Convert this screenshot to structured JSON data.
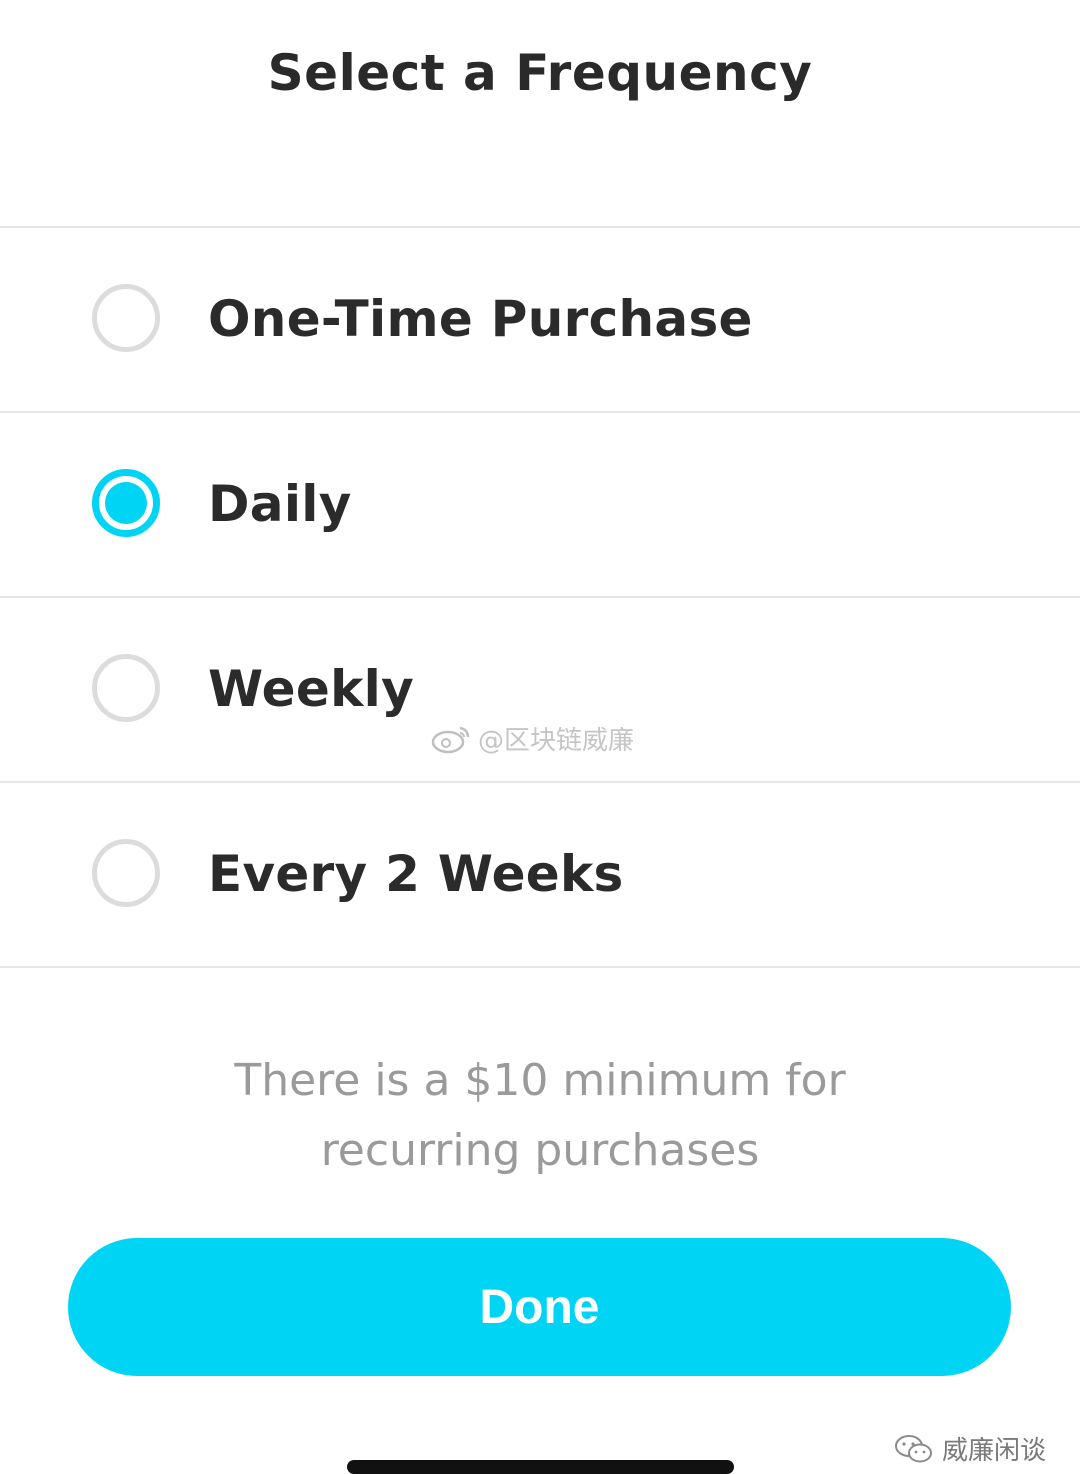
{
  "title": "Select a Frequency",
  "options": [
    {
      "label": "One-Time Purchase",
      "selected": false
    },
    {
      "label": "Daily",
      "selected": true
    },
    {
      "label": "Weekly",
      "selected": false
    },
    {
      "label": "Every 2 Weeks",
      "selected": false
    }
  ],
  "note": {
    "line1": "There is a $10 minimum for",
    "line2": "recurring purchases"
  },
  "done_label": "Done",
  "watermark": "@区块链威廉",
  "footer_watermark": "威廉闲谈",
  "colors": {
    "accent": "#00d4f5",
    "radio_unselected": "#dcdcdc",
    "text": "#2b2b2b",
    "note_text": "#9a9a9a"
  }
}
